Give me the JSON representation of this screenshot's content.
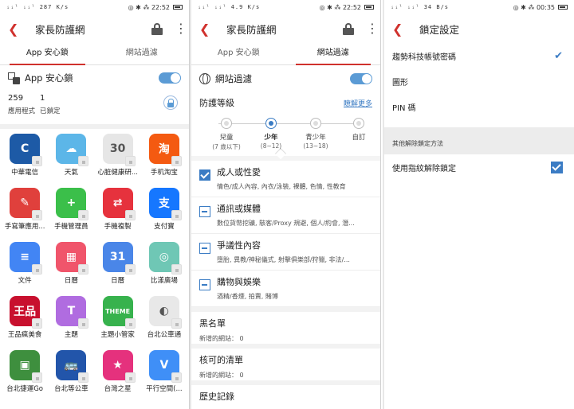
{
  "status": {
    "s1": {
      "left": "ᵢᵢˡ ᵢᵢˡ 287 K/s",
      "right": "◎ ✱ ⁂ 22:52"
    },
    "s2": {
      "left": "ᵢᵢˡ ᵢᵢˡ 4.9 K/s",
      "right": "◎ ✱ ⁂ 22:52"
    },
    "s3": {
      "left": "ᵢᵢˡ ᵢᵢˡ 34 B/s",
      "right": "◎ ✱ ⁂ 00:35"
    }
  },
  "screen1": {
    "title": "家長防護網",
    "tabs": [
      "App 安心鎖",
      "網站過濾"
    ],
    "section_label": "App 安心鎖",
    "counts": [
      {
        "num": "259",
        "label": "應用程式"
      },
      {
        "num": "1",
        "label": "已鎖定"
      }
    ],
    "apps": [
      {
        "name": "中華電信",
        "glyph": "C",
        "bg": "#1d5aa6"
      },
      {
        "name": "天氣",
        "glyph": "☁",
        "bg": "#5cb6e8"
      },
      {
        "name": "心脏健康研...",
        "glyph": "30",
        "bg": "#e6e6e6"
      },
      {
        "name": "手机淘宝",
        "glyph": "淘",
        "bg": "#f45a11"
      },
      {
        "name": "手寫筆應用...",
        "glyph": "✎",
        "bg": "#e0403c"
      },
      {
        "name": "手機管理員",
        "glyph": "+",
        "bg": "#3bbf4a"
      },
      {
        "name": "手機複製",
        "glyph": "⇄",
        "bg": "#e6323d"
      },
      {
        "name": "支付寶",
        "glyph": "支",
        "bg": "#1677ff"
      },
      {
        "name": "文件",
        "glyph": "≡",
        "bg": "#4285f4"
      },
      {
        "name": "日曆",
        "glyph": "▦",
        "bg": "#f0556b"
      },
      {
        "name": "日曆",
        "glyph": "31",
        "bg": "#4a86e8"
      },
      {
        "name": "比漾廣場",
        "glyph": "◎",
        "bg": "#6fc7b5"
      },
      {
        "name": "王品瘋美食",
        "glyph": "王品",
        "bg": "#c8102e"
      },
      {
        "name": "主題",
        "glyph": "T",
        "bg": "#b06ce0"
      },
      {
        "name": "主題小管家",
        "glyph": "THEME",
        "bg": "#37b24d"
      },
      {
        "name": "台北公車通",
        "glyph": "◐",
        "bg": "#e8e8e8"
      },
      {
        "name": "台北捷運Go",
        "glyph": "▣",
        "bg": "#3e8f3e"
      },
      {
        "name": "台北等公車",
        "glyph": "🚌",
        "bg": "#2255aa"
      },
      {
        "name": "台灣之星",
        "glyph": "★",
        "bg": "#e5317d"
      },
      {
        "name": "平行空間(...",
        "glyph": "V",
        "bg": "#3f8ff7"
      }
    ]
  },
  "screen2": {
    "title": "家長防護網",
    "tabs": [
      "App 安心鎖",
      "網站過濾"
    ],
    "section_label": "網站過濾",
    "level_label": "防護等級",
    "learn_more": "瞭解更多",
    "levels": [
      {
        "l1": "兒童",
        "l2": "(7 歲以下)"
      },
      {
        "l1": "少年",
        "l2": "(8~12)"
      },
      {
        "l1": "青少年",
        "l2": "(13~18)"
      },
      {
        "l1": "自訂",
        "l2": ""
      }
    ],
    "selected_level": 1,
    "categories": [
      {
        "title": "成人或性愛",
        "desc": "情色/成人內容, 內衣/泳裝, 裸體, 色情, 性教育",
        "state": "full"
      },
      {
        "title": "通訊或媒體",
        "desc": "數位貨幣挖礦, 駭客/Proxy 規避, 個人/約會, 潛...",
        "state": "part"
      },
      {
        "title": "爭議性內容",
        "desc": "墮胎, 異教/神秘儀式, 射擊俱樂部/狩獵, 非法/...",
        "state": "part"
      },
      {
        "title": "購物與娛樂",
        "desc": "酒精/香煙, 拍賣, 賭博",
        "state": "part"
      }
    ],
    "blocked": {
      "title": "黑名單",
      "desc": "新增的網站： 0"
    },
    "allowed": {
      "title": "核可的清單",
      "desc": "新增的網站： 0"
    },
    "more": "歷史記錄"
  },
  "screen3": {
    "title": "鎖定設定",
    "options": [
      {
        "label": "趨勢科技帳號密碼",
        "selected": true
      },
      {
        "label": "圖形",
        "selected": false
      },
      {
        "label": "PIN 碼",
        "selected": false
      }
    ],
    "other_section": "其他解除鎖定方法",
    "fingerprint": "使用指紋解除鎖定"
  },
  "colors": {
    "accent_red": "#d0312d",
    "accent_blue": "#3b7cc4"
  }
}
